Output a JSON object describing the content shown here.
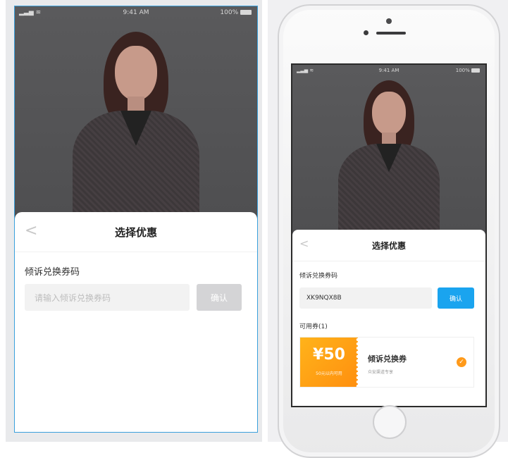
{
  "status_bar": {
    "time": "9:41 AM",
    "battery": "100%"
  },
  "sheet": {
    "title": "选择优惠",
    "code_label": "倾诉兑换券码",
    "input_placeholder": "请输入倾诉兑换券码",
    "input_value": "XK9NQX8B",
    "confirm_label": "确认",
    "available_label": "可用券(1)"
  },
  "coupon": {
    "amount": "¥50",
    "condition": "50元以内可用",
    "name": "倾诉兑换券",
    "subtitle": "众安渠道专享",
    "selected": true
  },
  "colors": {
    "confirm_active": "#1aa4ef",
    "confirm_disabled": "#d4d4d6",
    "coupon_orange": "#ff9a1a",
    "selection_border": "#3aa0dc"
  }
}
